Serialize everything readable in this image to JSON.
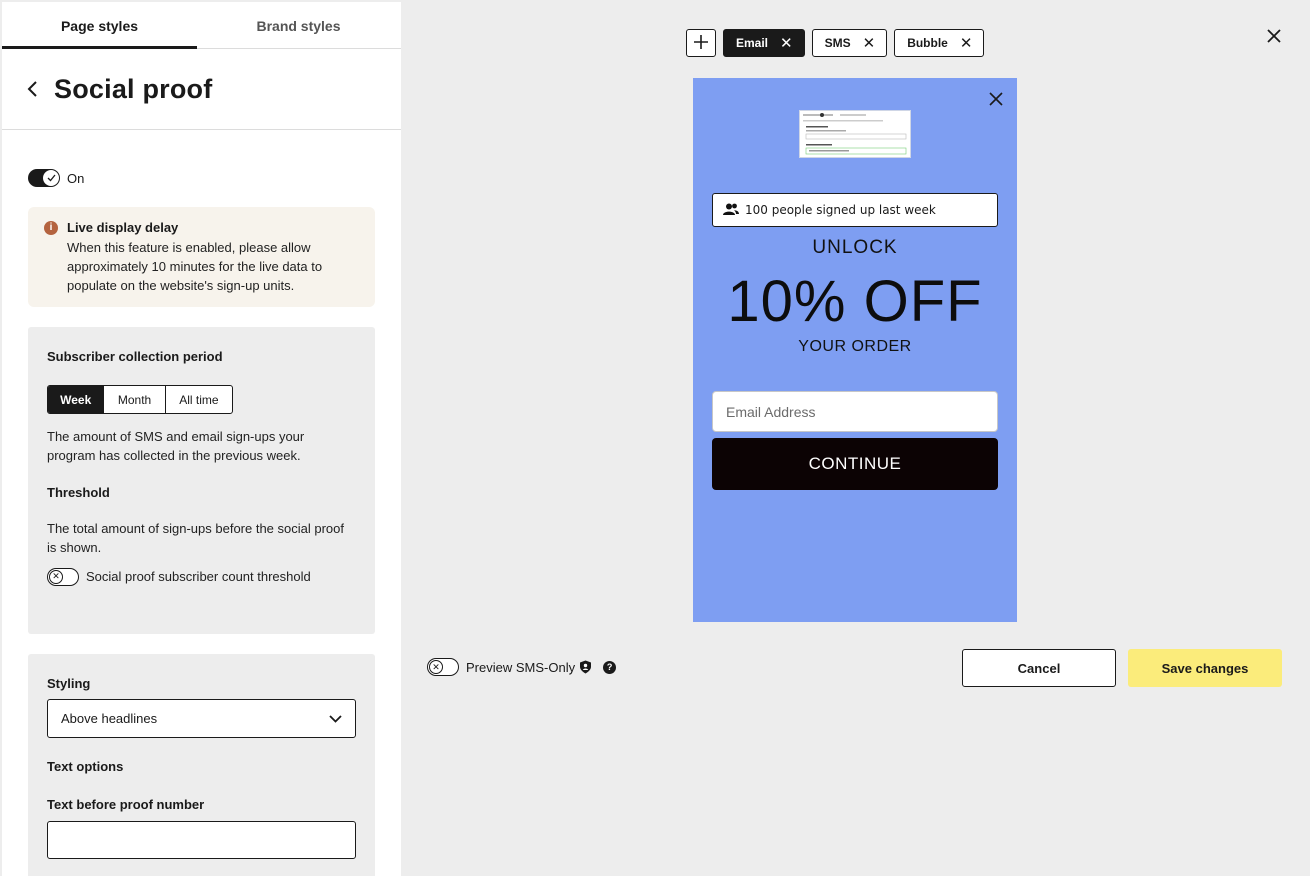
{
  "tabs": [
    {
      "label": "Page styles"
    },
    {
      "label": "Brand styles"
    }
  ],
  "page": {
    "title": "Social proof"
  },
  "enabled_toggle": {
    "label": "On",
    "state": true
  },
  "alert": {
    "title": "Live display delay",
    "body": "When this feature is enabled, please allow approximately 10 minutes for the live data to populate on the website's sign-up units."
  },
  "collection": {
    "label": "Subscriber collection period",
    "options": [
      "Week",
      "Month",
      "All time"
    ],
    "selected": "Week",
    "description": "The amount of SMS and email sign-ups your program has collected in the previous week."
  },
  "threshold": {
    "label": "Threshold",
    "description": "The total amount of sign-ups before the social proof is shown.",
    "toggle_label": "Social proof subscriber count threshold",
    "toggle_state": false
  },
  "styling": {
    "label": "Styling",
    "selected": "Above headlines",
    "text_options_label": "Text options",
    "text_before_label": "Text before proof number",
    "text_before_value": ""
  },
  "channels": [
    {
      "label": "Email",
      "active": true
    },
    {
      "label": "SMS",
      "active": false
    },
    {
      "label": "Bubble",
      "active": false
    }
  ],
  "preview": {
    "proof_text": "100 people signed up last week",
    "headline_small": "UNLOCK",
    "headline_big": "10% OFF",
    "headline_sub": "YOUR ORDER",
    "email_placeholder": "Email Address",
    "cta_label": "CONTINUE",
    "background_color": "#7e9ef2",
    "cta_color": "#0c0304"
  },
  "footer": {
    "sms_preview_label": "Preview SMS-Only",
    "cancel_label": "Cancel",
    "save_label": "Save changes",
    "save_color": "#fbec7b"
  }
}
